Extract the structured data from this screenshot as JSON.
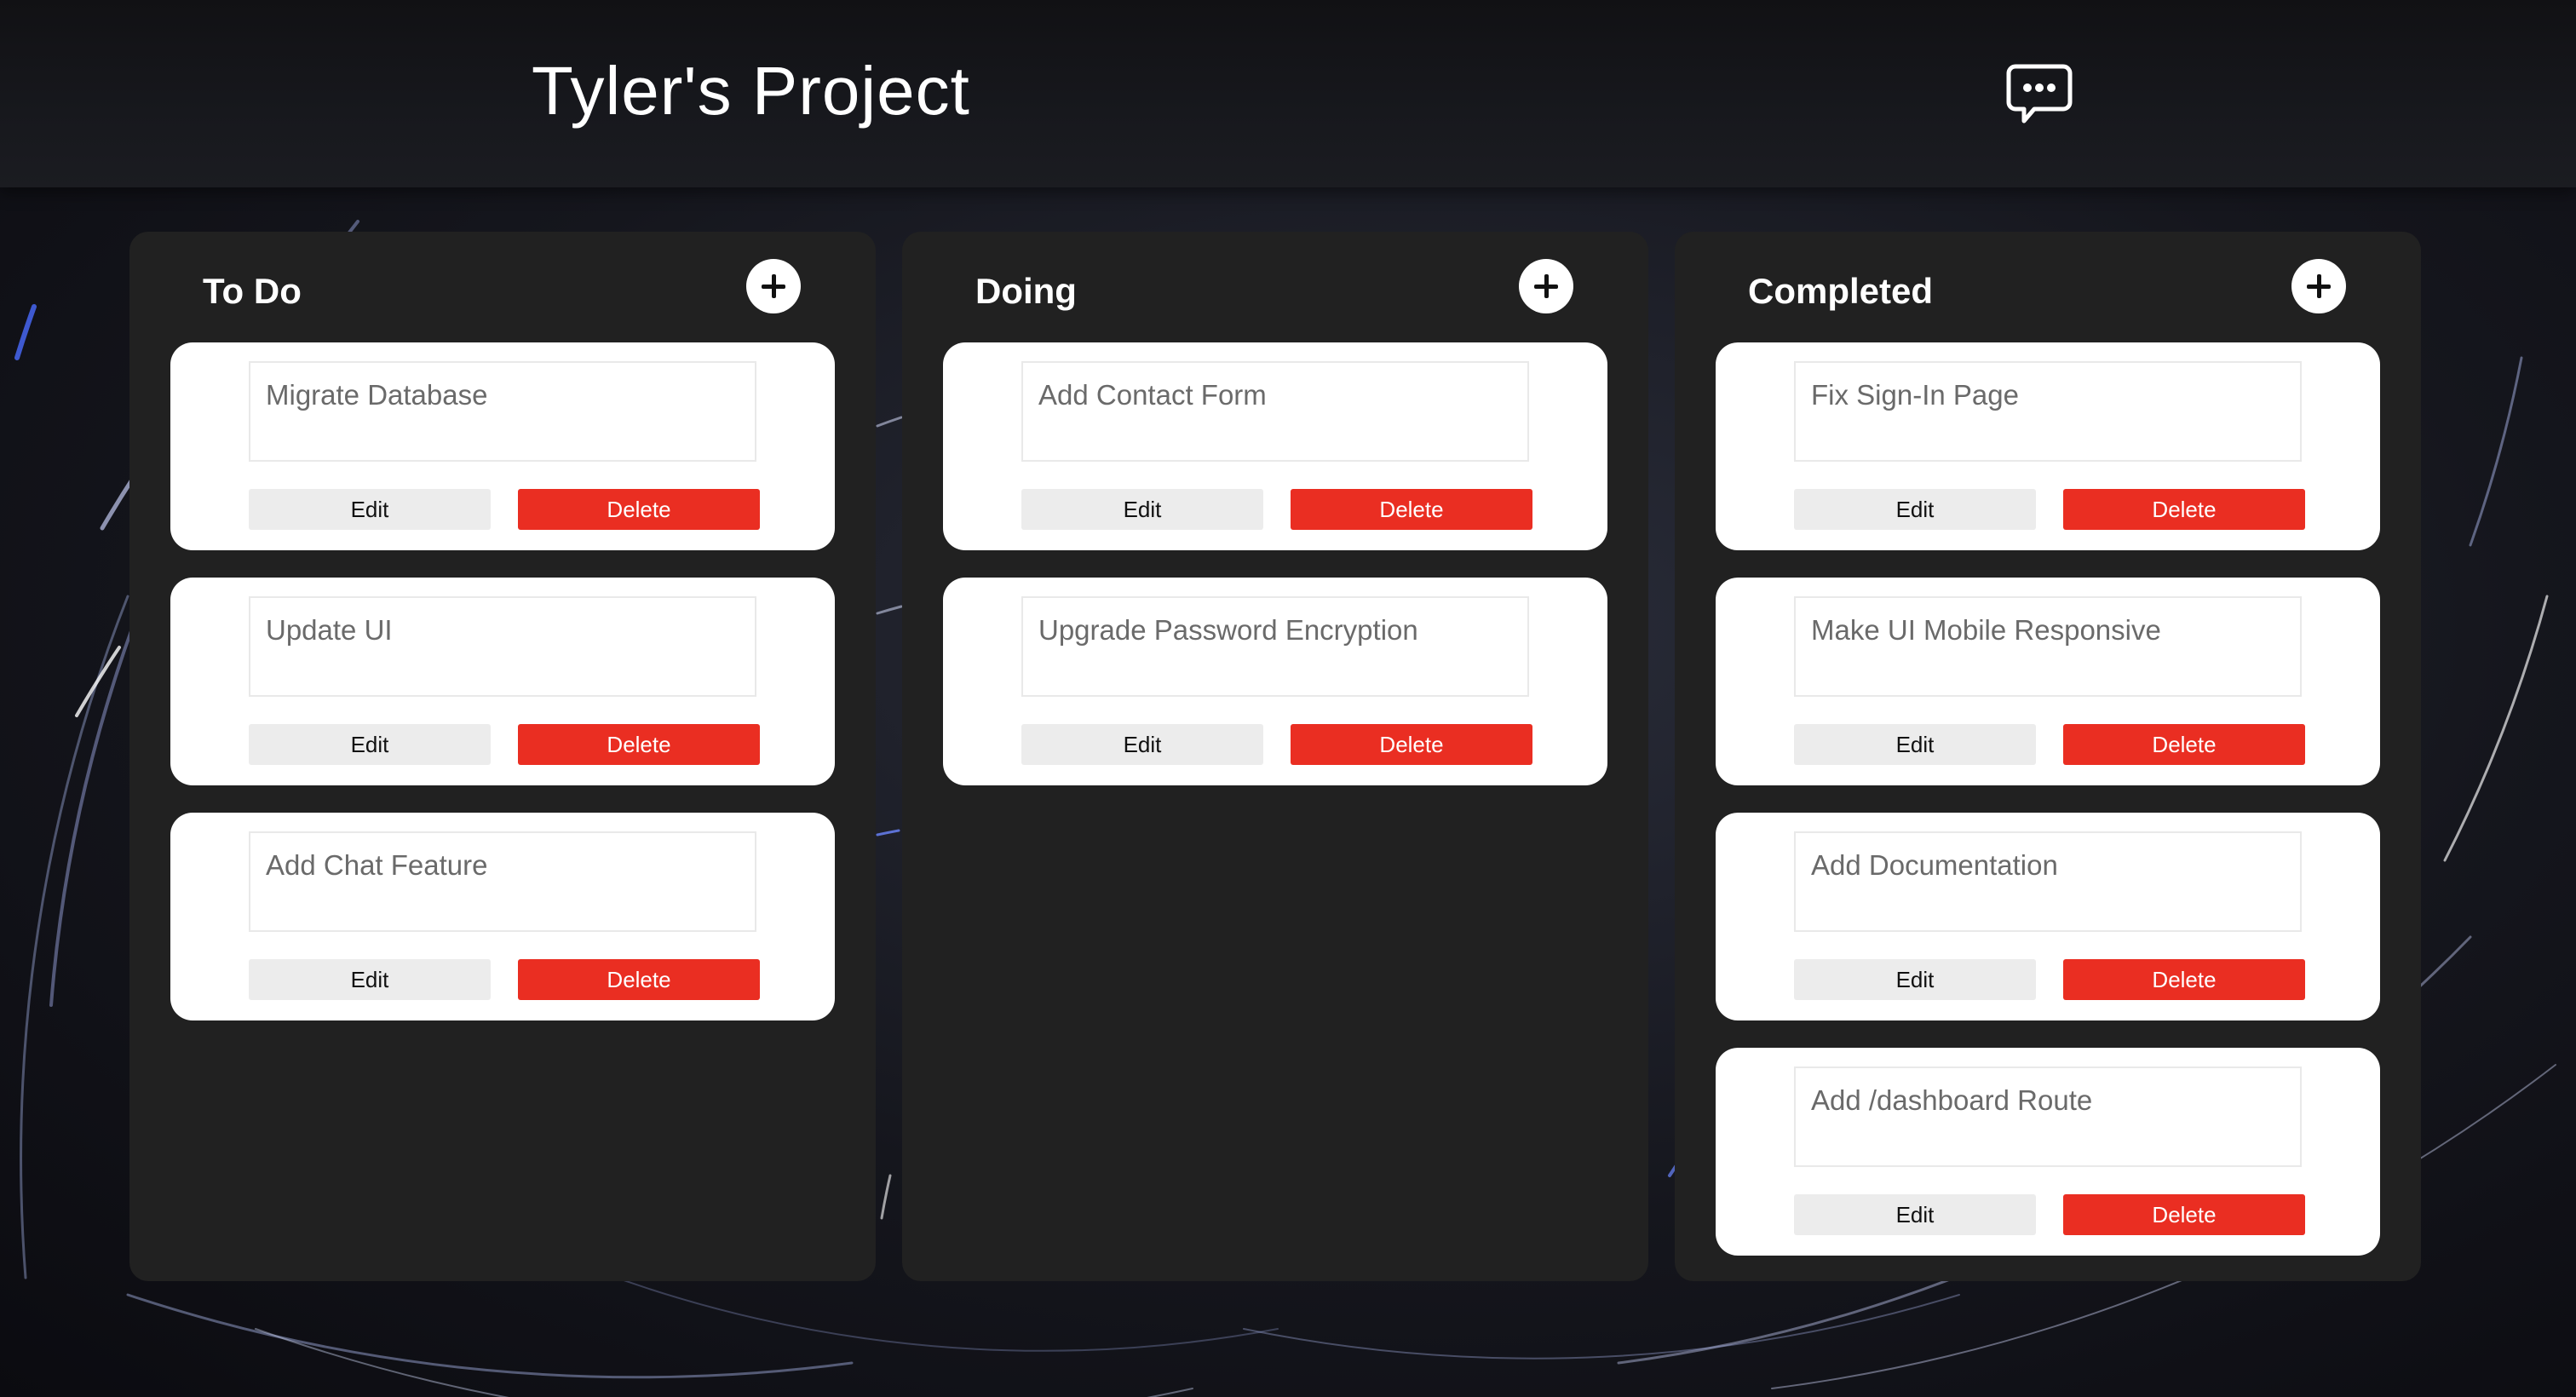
{
  "header": {
    "title": "Tyler's Project",
    "chat_icon": "chat-bubble-ellipsis-icon"
  },
  "colors": {
    "background": "#15161d",
    "header": "#17181d",
    "column": "#212121",
    "card": "#ffffff",
    "edit": "#ececec",
    "delete": "#ea2e22"
  },
  "icons": {
    "add": "plus-icon"
  },
  "columns": [
    {
      "title": "To Do",
      "cards": [
        {
          "text": "Migrate Database",
          "edit": "Edit",
          "delete": "Delete"
        },
        {
          "text": "Update UI",
          "edit": "Edit",
          "delete": "Delete"
        },
        {
          "text": "Add Chat Feature",
          "edit": "Edit",
          "delete": "Delete"
        }
      ]
    },
    {
      "title": "Doing",
      "cards": [
        {
          "text": "Add Contact Form",
          "edit": "Edit",
          "delete": "Delete"
        },
        {
          "text": "Upgrade Password Encryption",
          "edit": "Edit",
          "delete": "Delete"
        }
      ]
    },
    {
      "title": "Completed",
      "cards": [
        {
          "text": "Fix Sign-In Page",
          "edit": "Edit",
          "delete": "Delete"
        },
        {
          "text": "Make UI Mobile Responsive",
          "edit": "Edit",
          "delete": "Delete"
        },
        {
          "text": "Add Documentation",
          "edit": "Edit",
          "delete": "Delete"
        },
        {
          "text": "Add /dashboard Route",
          "edit": "Edit",
          "delete": "Delete"
        }
      ]
    }
  ]
}
